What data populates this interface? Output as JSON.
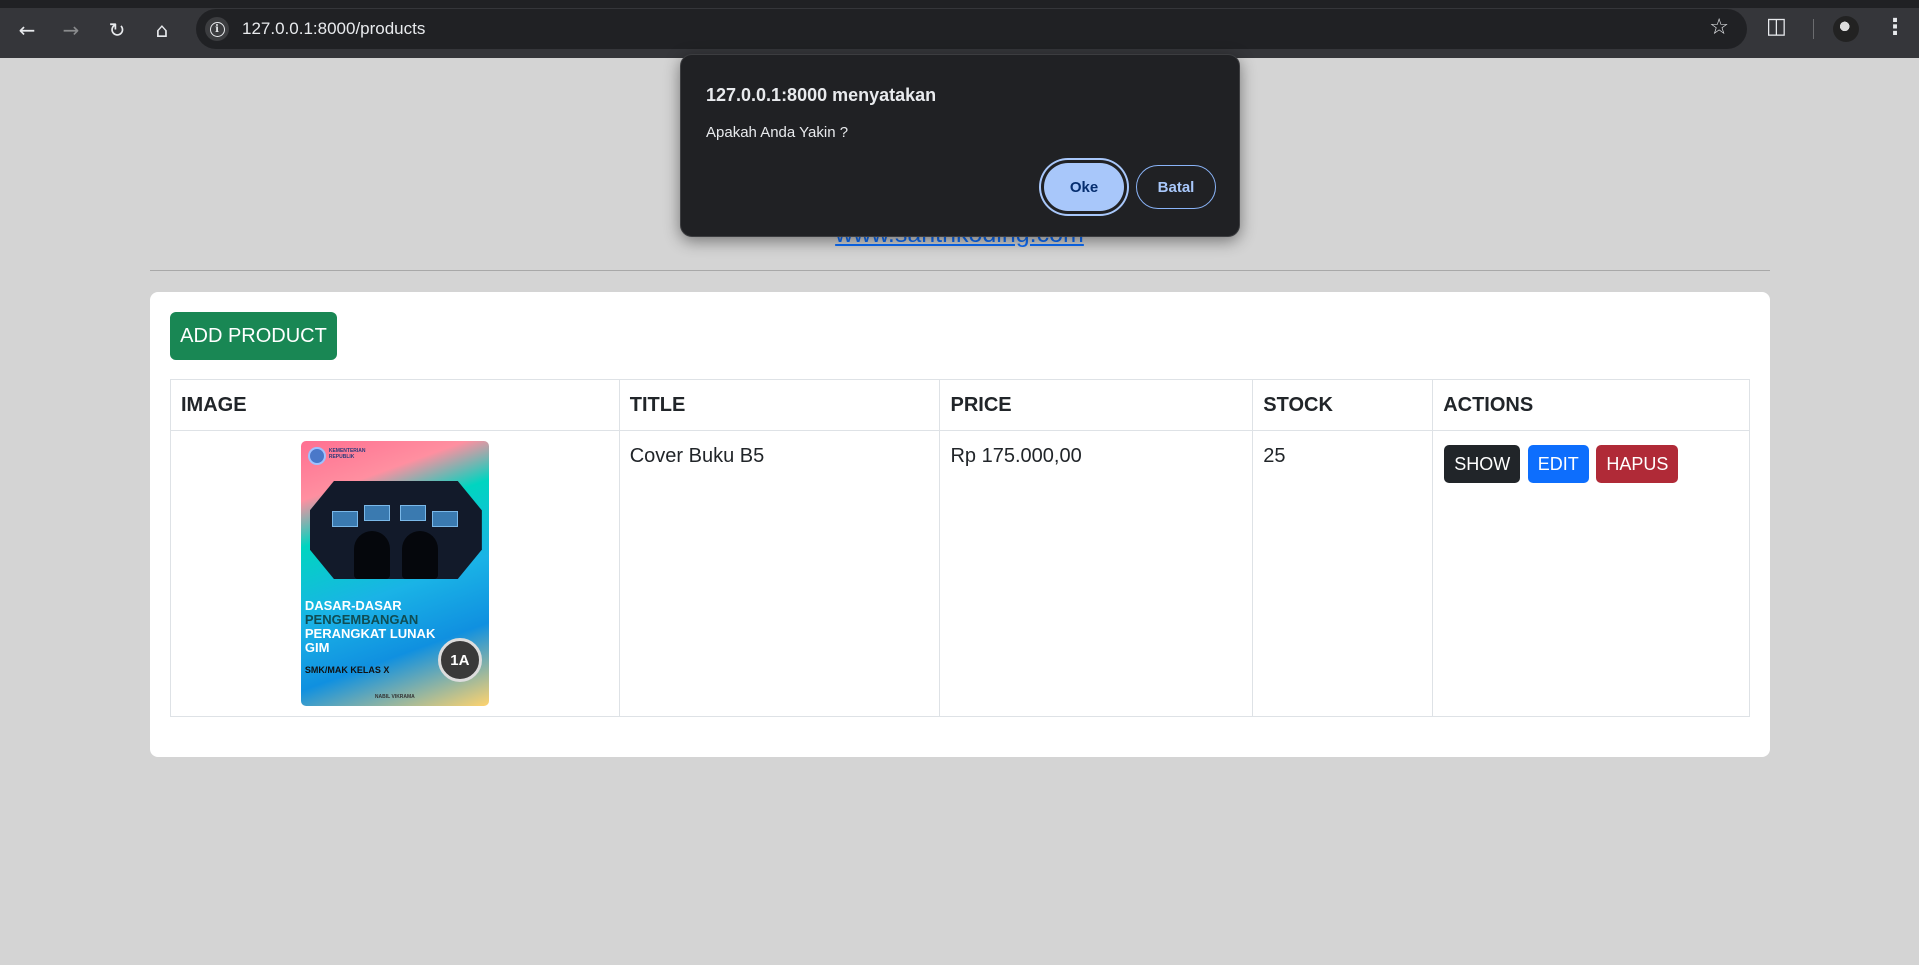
{
  "browser": {
    "url": "127.0.0.1:8000/products",
    "icons": {
      "back": "arrow-left-icon",
      "forward": "arrow-right-icon",
      "reload": "reload-icon",
      "home": "home-icon",
      "info": "info-icon",
      "bookmark": "star-icon",
      "extensions": "puzzle-icon",
      "menu": "more-vert-icon"
    }
  },
  "page": {
    "link_text": "www.santrikoding.com",
    "add_button_label": "ADD PRODUCT"
  },
  "table": {
    "headers": {
      "image": "IMAGE",
      "title": "TITLE",
      "price": "PRICE",
      "stock": "STOCK",
      "actions": "ACTIONS"
    },
    "rows": [
      {
        "cover": {
          "publisher": "KEMENTERIAN",
          "publisher_sub": "REPUBLIK",
          "title_line1": "DASAR-DASAR",
          "title_line2": "PENGEMBANGAN",
          "title_line3": "PERANGKAT LUNAK",
          "title_line4": "GIM",
          "subtitle": "SMK/MAK KELAS X",
          "badge": "1A",
          "author": "NABIL VIKRAMA"
        },
        "title": "Cover Buku B5",
        "price": "Rp 175.000,00",
        "stock": "25",
        "actions": {
          "show": "SHOW",
          "edit": "EDIT",
          "delete": "HAPUS"
        }
      }
    ]
  },
  "dialog": {
    "title": "127.0.0.1:8000 menyatakan",
    "message": "Apakah Anda Yakin ?",
    "ok_label": "Oke",
    "cancel_label": "Batal"
  },
  "colors": {
    "add_button": "#198754",
    "show_button": "#212529",
    "edit_button": "#0d6efd",
    "delete_button": "#b02a37",
    "link": "#0d6efd",
    "dialog_bg": "#202124",
    "ok_button": "#a8c7fa"
  }
}
